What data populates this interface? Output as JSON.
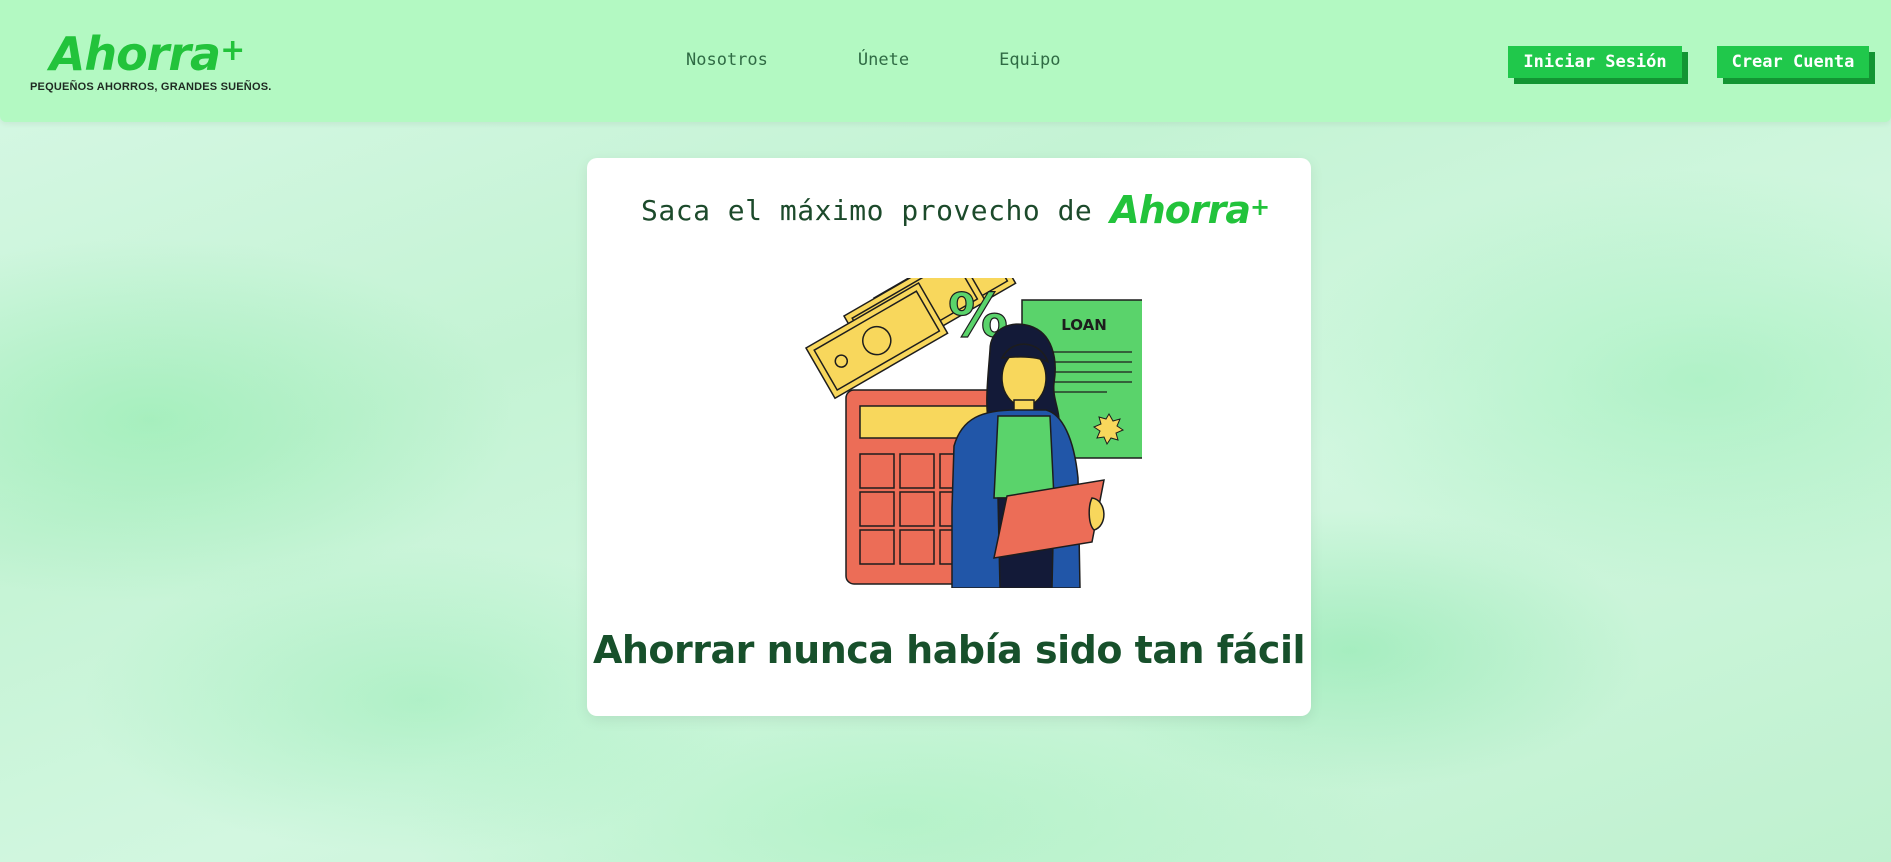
{
  "header": {
    "brand": {
      "logo_text": "Ahorra",
      "logo_plus": "+",
      "tagline": "PEQUEÑOS AHORROS, GRANDES SUEÑOS."
    },
    "nav": [
      {
        "label": "Nosotros"
      },
      {
        "label": "Únete"
      },
      {
        "label": "Equipo"
      }
    ],
    "login_label": "Iniciar Sesión",
    "signup_label": "Crear Cuenta"
  },
  "hero": {
    "heading": "Saca el máximo provecho de",
    "logo_text": "Ahorra",
    "logo_plus": "+",
    "illustration_text": "LOAN",
    "percent_symbol": "%",
    "tagline": "Ahorrar nunca había sido tan fácil"
  },
  "colors": {
    "header_bg": "#b3f9c2",
    "brand_green": "#22c33b",
    "button_bg": "#20c84b",
    "button_shadow": "#139533",
    "heading_text": "#17502b"
  }
}
